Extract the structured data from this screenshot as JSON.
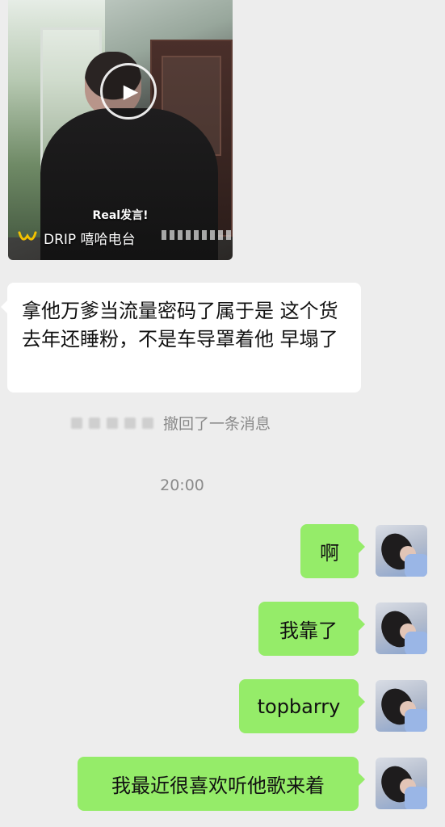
{
  "video": {
    "caption": "Real发言!",
    "footer_label": "DRIP 嘻哈电台"
  },
  "messages": {
    "left_text": "拿他万爹当流量密码了属于是 这个货去年还睡粉，不是车导罩着他  早塌了",
    "recall_text": "撤回了一条消息",
    "time": "20:00",
    "right": [
      {
        "text": "啊"
      },
      {
        "text": "我靠了"
      },
      {
        "text": "topbarry"
      },
      {
        "text": "我最近很喜欢听他歌来着"
      }
    ]
  },
  "colors": {
    "background": "#ededed",
    "incoming_bubble": "#ffffff",
    "outgoing_bubble": "#95ec69",
    "muted_text": "#8a8a8a"
  },
  "icons": [
    "play-icon",
    "drip-logo-icon"
  ]
}
